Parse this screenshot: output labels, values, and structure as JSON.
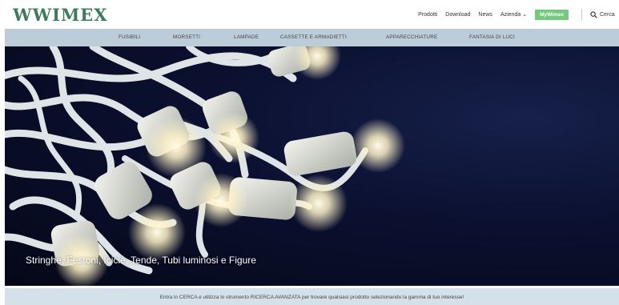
{
  "header": {
    "logo_text": "WWIMEX",
    "nav": {
      "prodotti": "Prodotti",
      "download": "Download",
      "news": "News",
      "azienda": "Azienda",
      "mywimex": "MyWimex",
      "search_label": "Cerca"
    }
  },
  "categories": [
    "FUSIBILI",
    "MORSETTI",
    "LAMPADE",
    "CASSETTE E ARMADIETTI",
    "APPARECCHIATURE",
    "FANTASIA DI LUCI"
  ],
  "hero": {
    "caption": "Stringhe, Festoni, Icicle, Tende, Tubi luminosi e Figure"
  },
  "info": {
    "text": "Entra in CERCA e utilizza lo strumento RICERCA AVANZATA per trovare qualsiasi prodotto selezionando la gamma di tuo interesse!"
  },
  "colors": {
    "brand_green": "#3f7a5a",
    "mywimex_green": "#74c97f",
    "nav_bar": "#bccdd9",
    "info_bar": "#d5e1ea"
  }
}
